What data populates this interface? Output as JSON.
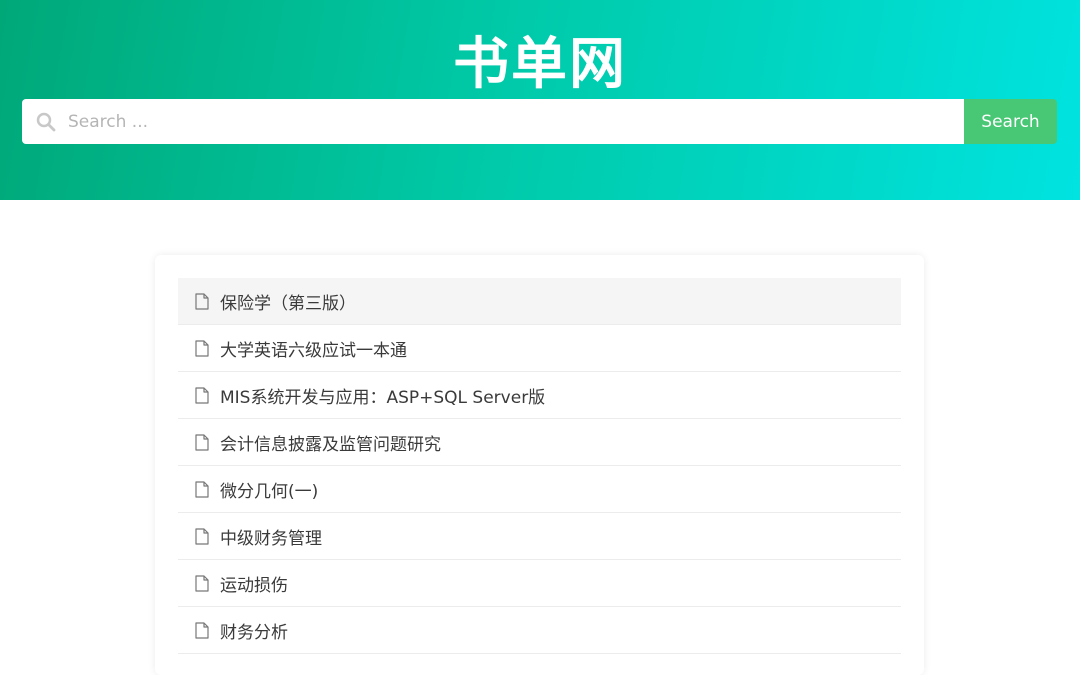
{
  "header": {
    "site_title": "书单网",
    "gradient_colors": [
      "#00a878",
      "#00e3e0"
    ]
  },
  "search": {
    "placeholder": "Search ...",
    "value": "",
    "button_label": "Search",
    "button_color": "#48c774",
    "icon": "search-icon"
  },
  "books": {
    "item_icon": "file-icon",
    "items": [
      {
        "title": "保险学（第三版）",
        "active": true
      },
      {
        "title": "大学英语六级应试一本通",
        "active": false
      },
      {
        "title": "MIS系统开发与应用：ASP+SQL Server版",
        "active": false
      },
      {
        "title": "会计信息披露及监管问题研究",
        "active": false
      },
      {
        "title": "微分几何(一)",
        "active": false
      },
      {
        "title": "中级财务管理",
        "active": false
      },
      {
        "title": "运动损伤",
        "active": false
      },
      {
        "title": "财务分析",
        "active": false
      }
    ]
  }
}
